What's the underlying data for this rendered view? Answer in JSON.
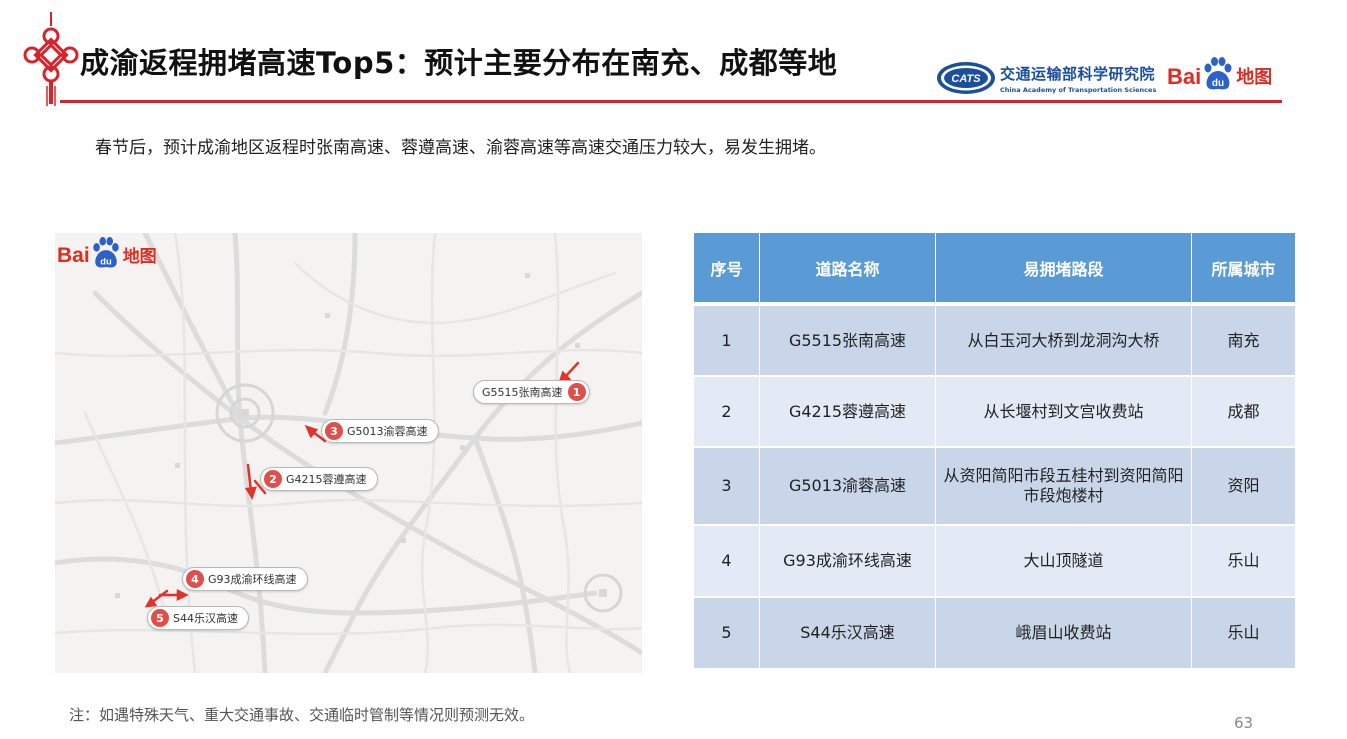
{
  "header": {
    "title": "成渝返程拥堵高速Top5：预计主要分布在南充、成都等地",
    "org_cn": "交通运输部科学研究院",
    "org_en": "China Academy of Transportation Sciences",
    "org_logo_text": "CATS",
    "baidu_bai": "Bai",
    "baidu_du": "du",
    "baidu_ditu": "地图",
    "accent_color": "#d8232a"
  },
  "intro": "春节后，预计成渝地区返程时张南高速、蓉遵高速、渝蓉高速等高速交通压力较大，易发生拥堵。",
  "map": {
    "baidu_bai": "Bai",
    "baidu_du": "du",
    "baidu_ditu": "地图",
    "pins": [
      {
        "num": "1",
        "label": "G5515张南高速"
      },
      {
        "num": "2",
        "label": "G4215蓉遵高速"
      },
      {
        "num": "3",
        "label": "G5013渝蓉高速"
      },
      {
        "num": "4",
        "label": "G93成渝环线高速"
      },
      {
        "num": "5",
        "label": "S44乐汉高速"
      }
    ]
  },
  "table": {
    "headers": [
      "序号",
      "道路名称",
      "易拥堵路段",
      "所属城市"
    ],
    "rows": [
      [
        "1",
        "G5515张南高速",
        "从白玉河大桥到龙洞沟大桥",
        "南充"
      ],
      [
        "2",
        "G4215蓉遵高速",
        "从长堰村到文宫收费站",
        "成都"
      ],
      [
        "3",
        "G5013渝蓉高速",
        "从资阳简阳市段五桂村到资阳简阳市段炮楼村",
        "资阳"
      ],
      [
        "4",
        "G93成渝环线高速",
        "大山顶隧道",
        "乐山"
      ],
      [
        "5",
        "S44乐汉高速",
        "峨眉山收费站",
        "乐山"
      ]
    ],
    "header_color": "#5b9bd5"
  },
  "note": "注：如遇特殊天气、重大交通事故、交通临时管制等情况则预测无效。",
  "page_number": "63"
}
